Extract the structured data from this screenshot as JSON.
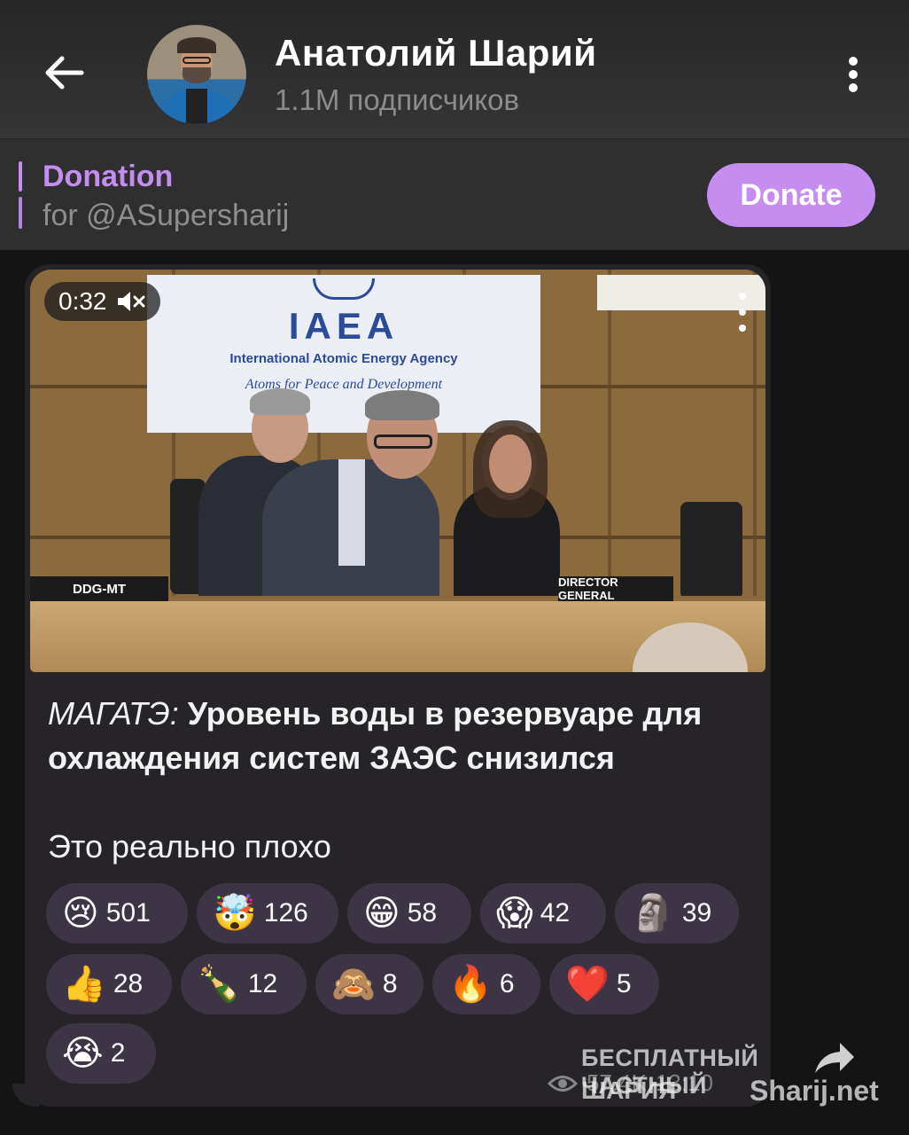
{
  "header": {
    "channel_name": "Анатолий Шарий",
    "subscribers": "1.1M подписчиков",
    "back_icon": "arrow-left-icon",
    "menu_icon": "more-vertical-icon"
  },
  "pinned": {
    "title": "Donation",
    "text": "for @ASupersharij",
    "button_label": "Donate",
    "accent_color": "#c58df0"
  },
  "video": {
    "duration": "0:32",
    "muted_icon": "speaker-muted-icon",
    "banner_acronym": "IAEA",
    "banner_name": "International Atomic Energy Agency",
    "banner_motto": "Atoms for Peace and Development",
    "nameplate_left": "DDG-MT",
    "nameplate_right": "DIRECTOR GENERAL"
  },
  "message": {
    "source": "МАГАТЭ:",
    "headline": "Уровень воды в резервуаре для охлаждения систем ЗАЭС снизился",
    "comment": "Это реально плохо"
  },
  "reactions": [
    {
      "emoji": "😢",
      "count": "501"
    },
    {
      "emoji": "🤯",
      "count": "126"
    },
    {
      "emoji": "😁",
      "count": "58"
    },
    {
      "emoji": "😱",
      "count": "42"
    },
    {
      "emoji": "🗿",
      "count": "39"
    },
    {
      "emoji": "👍",
      "count": "28"
    },
    {
      "emoji": "🍾",
      "count": "12"
    },
    {
      "emoji": "🙈",
      "count": "8"
    },
    {
      "emoji": "🔥",
      "count": "6"
    },
    {
      "emoji": "❤️",
      "count": "5"
    },
    {
      "emoji": "😭",
      "count": "2"
    }
  ],
  "meta": {
    "views": "57.4K",
    "time": "13:10"
  },
  "watermark": {
    "line1": "БЕСПЛАТНЫЙ ЧАСТНЫЙ",
    "line2": "ШАРИЯ",
    "line3": "Sharij.net"
  }
}
